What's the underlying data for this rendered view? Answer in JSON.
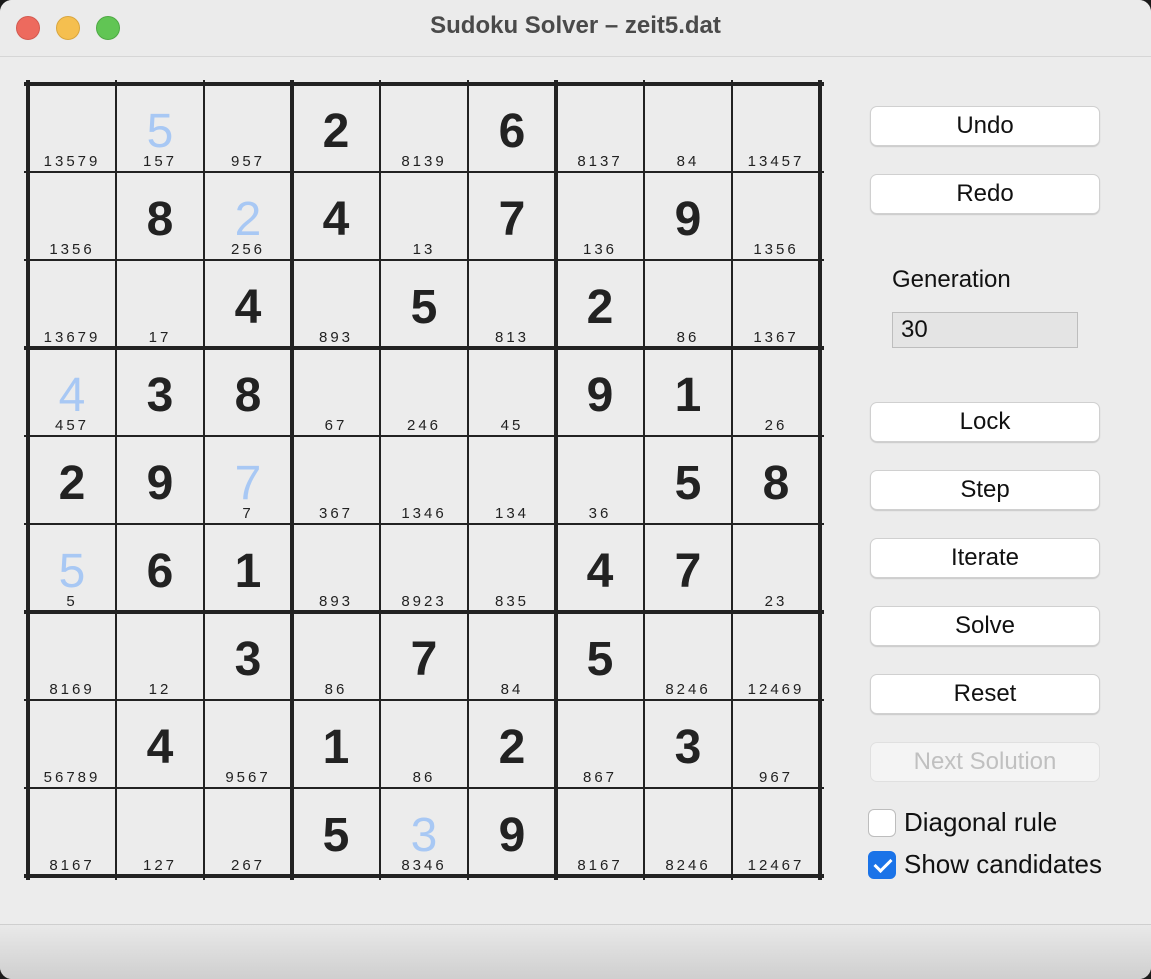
{
  "window": {
    "title": "Sudoku Solver – zeit5.dat"
  },
  "board": {
    "cells": [
      [
        {
          "v": "",
          "h": false,
          "c": "13579"
        },
        {
          "v": "5",
          "h": true,
          "c": "157"
        },
        {
          "v": "",
          "h": false,
          "c": "957"
        },
        {
          "v": "2",
          "h": false,
          "c": ""
        },
        {
          "v": "",
          "h": false,
          "c": "8139"
        },
        {
          "v": "6",
          "h": false,
          "c": ""
        },
        {
          "v": "",
          "h": false,
          "c": "8137"
        },
        {
          "v": "",
          "h": false,
          "c": "84"
        },
        {
          "v": "",
          "h": false,
          "c": "13457"
        }
      ],
      [
        {
          "v": "",
          "h": false,
          "c": "1356"
        },
        {
          "v": "8",
          "h": false,
          "c": ""
        },
        {
          "v": "2",
          "h": true,
          "c": "256"
        },
        {
          "v": "4",
          "h": false,
          "c": ""
        },
        {
          "v": "",
          "h": false,
          "c": "13"
        },
        {
          "v": "7",
          "h": false,
          "c": ""
        },
        {
          "v": "",
          "h": false,
          "c": "136"
        },
        {
          "v": "9",
          "h": false,
          "c": ""
        },
        {
          "v": "",
          "h": false,
          "c": "1356"
        }
      ],
      [
        {
          "v": "",
          "h": false,
          "c": "13679"
        },
        {
          "v": "",
          "h": false,
          "c": "17"
        },
        {
          "v": "4",
          "h": false,
          "c": ""
        },
        {
          "v": "",
          "h": false,
          "c": "893"
        },
        {
          "v": "5",
          "h": false,
          "c": ""
        },
        {
          "v": "",
          "h": false,
          "c": "813"
        },
        {
          "v": "2",
          "h": false,
          "c": ""
        },
        {
          "v": "",
          "h": false,
          "c": "86"
        },
        {
          "v": "",
          "h": false,
          "c": "1367"
        }
      ],
      [
        {
          "v": "4",
          "h": true,
          "c": "457"
        },
        {
          "v": "3",
          "h": false,
          "c": ""
        },
        {
          "v": "8",
          "h": false,
          "c": ""
        },
        {
          "v": "",
          "h": false,
          "c": "67"
        },
        {
          "v": "",
          "h": false,
          "c": "246"
        },
        {
          "v": "",
          "h": false,
          "c": "45"
        },
        {
          "v": "9",
          "h": false,
          "c": ""
        },
        {
          "v": "1",
          "h": false,
          "c": ""
        },
        {
          "v": "",
          "h": false,
          "c": "26"
        }
      ],
      [
        {
          "v": "2",
          "h": false,
          "c": ""
        },
        {
          "v": "9",
          "h": false,
          "c": ""
        },
        {
          "v": "7",
          "h": true,
          "c": "7"
        },
        {
          "v": "",
          "h": false,
          "c": "367"
        },
        {
          "v": "",
          "h": false,
          "c": "1346"
        },
        {
          "v": "",
          "h": false,
          "c": "134"
        },
        {
          "v": "",
          "h": false,
          "c": "36"
        },
        {
          "v": "5",
          "h": false,
          "c": ""
        },
        {
          "v": "8",
          "h": false,
          "c": ""
        }
      ],
      [
        {
          "v": "5",
          "h": true,
          "c": "5"
        },
        {
          "v": "6",
          "h": false,
          "c": ""
        },
        {
          "v": "1",
          "h": false,
          "c": ""
        },
        {
          "v": "",
          "h": false,
          "c": "893"
        },
        {
          "v": "",
          "h": false,
          "c": "8923"
        },
        {
          "v": "",
          "h": false,
          "c": "835"
        },
        {
          "v": "4",
          "h": false,
          "c": ""
        },
        {
          "v": "7",
          "h": false,
          "c": ""
        },
        {
          "v": "",
          "h": false,
          "c": "23"
        }
      ],
      [
        {
          "v": "",
          "h": false,
          "c": "8169"
        },
        {
          "v": "",
          "h": false,
          "c": "12"
        },
        {
          "v": "3",
          "h": false,
          "c": ""
        },
        {
          "v": "",
          "h": false,
          "c": "86"
        },
        {
          "v": "7",
          "h": false,
          "c": ""
        },
        {
          "v": "",
          "h": false,
          "c": "84"
        },
        {
          "v": "5",
          "h": false,
          "c": ""
        },
        {
          "v": "",
          "h": false,
          "c": "8246"
        },
        {
          "v": "",
          "h": false,
          "c": "12469"
        }
      ],
      [
        {
          "v": "",
          "h": false,
          "c": "56789"
        },
        {
          "v": "4",
          "h": false,
          "c": ""
        },
        {
          "v": "",
          "h": false,
          "c": "9567"
        },
        {
          "v": "1",
          "h": false,
          "c": ""
        },
        {
          "v": "",
          "h": false,
          "c": "86"
        },
        {
          "v": "2",
          "h": false,
          "c": ""
        },
        {
          "v": "",
          "h": false,
          "c": "867"
        },
        {
          "v": "3",
          "h": false,
          "c": ""
        },
        {
          "v": "",
          "h": false,
          "c": "967"
        }
      ],
      [
        {
          "v": "",
          "h": false,
          "c": "8167"
        },
        {
          "v": "",
          "h": false,
          "c": "127"
        },
        {
          "v": "",
          "h": false,
          "c": "267"
        },
        {
          "v": "5",
          "h": false,
          "c": ""
        },
        {
          "v": "3",
          "h": true,
          "c": "8346"
        },
        {
          "v": "9",
          "h": false,
          "c": ""
        },
        {
          "v": "",
          "h": false,
          "c": "8167"
        },
        {
          "v": "",
          "h": false,
          "c": "8246"
        },
        {
          "v": "",
          "h": false,
          "c": "12467"
        }
      ]
    ]
  },
  "controls": {
    "undo": "Undo",
    "redo": "Redo",
    "generation_label": "Generation",
    "generation_value": "30",
    "lock": "Lock",
    "step": "Step",
    "iterate": "Iterate",
    "solve": "Solve",
    "reset": "Reset",
    "next_solution": "Next Solution",
    "diagonal_rule": "Diagonal rule",
    "diagonal_rule_checked": false,
    "show_candidates": "Show candidates",
    "show_candidates_checked": true
  },
  "colors": {
    "hint_digit": "#a8c8f4",
    "checkbox_accent": "#1a73e8"
  }
}
